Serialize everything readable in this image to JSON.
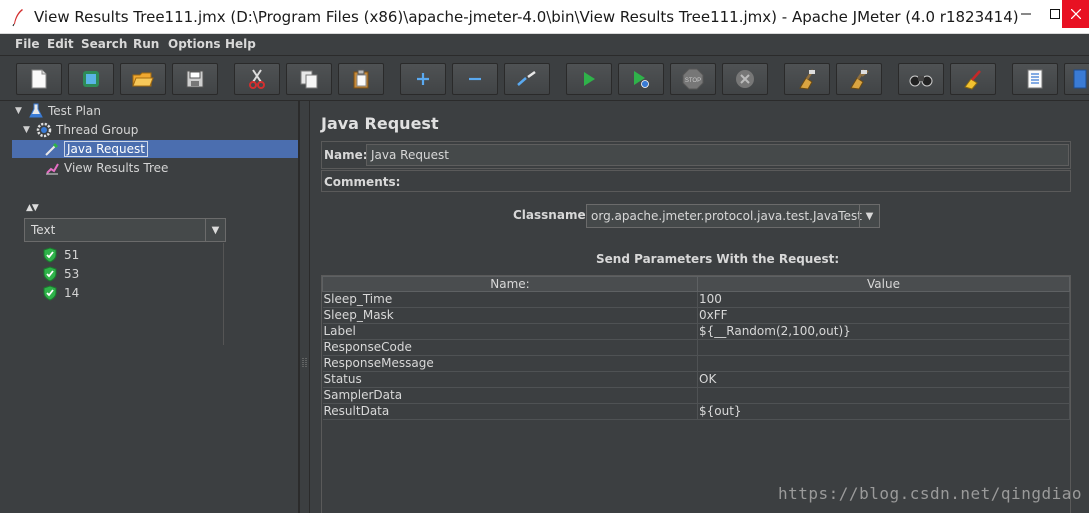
{
  "window": {
    "title": "View Results Tree111.jmx (D:\\Program Files (x86)\\apache-jmeter-4.0\\bin\\View Results Tree111.jmx) - Apache JMeter (4.0 r1823414)"
  },
  "menu": [
    "File",
    "Edit",
    "Search",
    "Run",
    "Options",
    "Help"
  ],
  "toolbar": {
    "buttons": [
      "new",
      "templates",
      "open",
      "save",
      "cut",
      "copy",
      "paste",
      "expand",
      "collapse",
      "toggle",
      "start",
      "start-no-pause",
      "stop",
      "shutdown",
      "clear",
      "clear-all",
      "search",
      "reset-search",
      "function-helper",
      "help"
    ]
  },
  "tree": {
    "items": [
      {
        "label": "Test Plan",
        "icon": "flask-icon"
      },
      {
        "label": "Thread Group",
        "icon": "gear-icon"
      },
      {
        "label": "Java Request",
        "icon": "pipette-icon"
      },
      {
        "label": "View Results Tree",
        "icon": "chart-icon"
      }
    ]
  },
  "results": {
    "renderer": "Text",
    "items": [
      "51",
      "53",
      "14"
    ]
  },
  "panel": {
    "title": "Java Request",
    "name_label": "Name:",
    "name_value": "Java Request",
    "comments_label": "Comments:",
    "classname_label": "Classname:",
    "classname_value": "org.apache.jmeter.protocol.java.test.JavaTest",
    "params_title": "Send Parameters With the Request:",
    "params_headers": [
      "Name:",
      "Value"
    ],
    "params": [
      {
        "name": "Sleep_Time",
        "value": "100"
      },
      {
        "name": "Sleep_Mask",
        "value": "0xFF"
      },
      {
        "name": "Label",
        "value": "${__Random(2,100,out)}"
      },
      {
        "name": "ResponseCode",
        "value": ""
      },
      {
        "name": "ResponseMessage",
        "value": ""
      },
      {
        "name": "Status",
        "value": "OK"
      },
      {
        "name": "SamplerData",
        "value": ""
      },
      {
        "name": "ResultData",
        "value": "${out}"
      }
    ]
  },
  "watermark": "https://blog.csdn.net/qingdiao",
  "colors": {
    "background": "#3c3f41",
    "selection": "#4b6eaf",
    "close_button": "#e81123"
  }
}
